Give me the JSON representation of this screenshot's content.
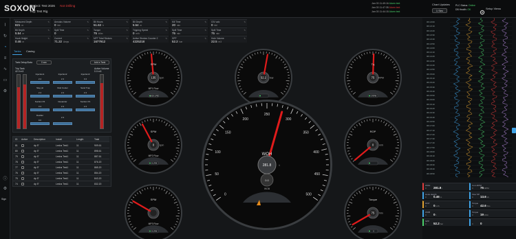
{
  "app": {
    "logo": "SOXON",
    "project": "Project:  Test 2026",
    "status": "Not Drilling",
    "rig": "Rig:  Test Rig"
  },
  "alarms": [
    {
      "time": "Jan 03 11:49:16",
      "text": "Alarm text"
    },
    {
      "time": "Jan 03 11:47:35",
      "text": "Alarm text"
    },
    {
      "time": "Jan 03 11:44:15",
      "text": "Alarm text"
    }
  ],
  "chart_updates": {
    "label": "Chart Updates",
    "value": "1 Sec"
  },
  "status_info": {
    "plc": "PLC Status:",
    "plc_val": "Online",
    "db": "DB Health:",
    "db_val": "OK"
  },
  "setup_label": "Setup Views",
  "sidebar": {
    "icons": [
      "chart-icon",
      "history-icon",
      "gauge-icon",
      "layers-icon",
      "trend-icon",
      "folder-icon",
      "settings-icon",
      "gear-icon"
    ],
    "bottom_label": "Sign"
  },
  "metrics": [
    {
      "label": "Measured Depth",
      "value": "821",
      "unit": "m"
    },
    {
      "label": "Annulus Volume",
      "value": "0",
      "unit": "bbl"
    },
    {
      "label": "Bit Hours",
      "value": "51.63",
      "unit": "h"
    },
    {
      "label": "Bit Depth",
      "value": "5.54",
      "unit": "m"
    },
    {
      "label": "Kill Time",
      "value": "20",
      "unit": "min"
    },
    {
      "label": "GIV calc",
      "value": "0",
      "unit": "bbl"
    },
    {
      "label": "Bit Depth",
      "value": "5.54",
      "unit": "m"
    },
    {
      "label": "Spill Time",
      "value": "0",
      "unit": ""
    },
    {
      "label": "Torque",
      "value": "75",
      "unit": "kNm"
    },
    {
      "label": "Tripping Speed",
      "value": "0",
      "unit": "m/h"
    },
    {
      "label": "Spill Time",
      "value": "75",
      "unit": "min"
    },
    {
      "label": "Spill Time",
      "value": "75",
      "unit": "min"
    },
    {
      "label": "Hook Height",
      "value": "0.46",
      "unit": "m"
    },
    {
      "label": "Current",
      "value": "71.22",
      "unit": "Amps"
    },
    {
      "label": "MFT Total Strokes",
      "value": "1677912",
      "unit": ""
    },
    {
      "label": "Active Strokes Counter 2",
      "value": "4225218",
      "unit": ""
    },
    {
      "label": "SPP",
      "value": "52.2",
      "unit": "bar"
    },
    {
      "label": "Hole Volume",
      "value": "22.5",
      "unit": "m3"
    }
  ],
  "left_panel": {
    "tabs": [
      "Tanks",
      "Casing"
    ],
    "delay_label": "Tank Delay/Data",
    "delay_value": "0 sec",
    "add_label": "Add a Tank",
    "trip_tank": "Trip Tank",
    "trip_val": "42.0 m3",
    "active_vol": "Active Volume",
    "active_val": "0.0 m3",
    "tanks": [
      {
        "name": "Injection1",
        "val": "2.4"
      },
      {
        "name": "Injection2",
        "val": "2.4"
      },
      {
        "name": "Injection3",
        "val": "3.4"
      },
      {
        "name": "Slug pit",
        "val": "2.4"
      },
      {
        "name": "Mud Cooler",
        "val": "2.4"
      },
      {
        "name": "Sand Trap",
        "val": "2.4"
      },
      {
        "name": "Suction P4",
        "val": "3.4"
      },
      {
        "name": "Desander",
        "val": "2.4"
      },
      {
        "name": "Suction P1",
        "val": "2.4"
      },
      {
        "name": "Desilter",
        "val": "0.0"
      },
      {
        "name": "",
        "val": "2.4"
      }
    ]
  },
  "table": {
    "headers": [
      "ID",
      "Active",
      "Description",
      "Install",
      "Length",
      "Total"
    ],
    "rows": [
      [
        "81",
        "",
        "dp 5\"",
        "Lesha Test1",
        "11",
        "909.61"
      ],
      [
        "80",
        "",
        "dp 5\"",
        "Lesha Test1",
        "11",
        "898.61"
      ],
      [
        "79",
        "",
        "dp 5\"",
        "Lesha Test1",
        "11",
        "887.61"
      ],
      [
        "78",
        "",
        "dp 5\"",
        "Lesha Test1",
        "11",
        "876.20"
      ],
      [
        "77",
        "",
        "dp 5\"",
        "Lesha Test1",
        "11",
        "865.20"
      ],
      [
        "76",
        "",
        "dp 5\"",
        "Lesha Test1",
        "11",
        "854.20"
      ],
      [
        "75",
        "",
        "dp 5\"",
        "Lesha Test1",
        "11",
        "843.20"
      ],
      [
        "74",
        "",
        "dp 5\"",
        "Lesha Test1",
        "11",
        "832.20"
      ]
    ]
  },
  "gauges": {
    "g1": {
      "title": "SPM",
      "value": "135",
      "unit": "spm",
      "sub": "MP1 Flow",
      "btn": "1000 LPM"
    },
    "g2": {
      "title": "",
      "value": "52.2",
      "unit": "Bar",
      "sub": "",
      "btn": ""
    },
    "g3": {
      "title": "Tq",
      "value": "75",
      "unit": "RPM",
      "sub": "",
      "btn": "0 RPM"
    },
    "g4": {
      "title": "SPM",
      "value": "0",
      "unit": "spm",
      "sub": "MP2 Flow",
      "btn": "0 LPM"
    },
    "g5": {
      "title": "ROP",
      "value": "0",
      "unit": "m/h",
      "sub": "",
      "btn": ""
    },
    "g6": {
      "title": "SPM",
      "value": "",
      "unit": "",
      "sub": "MP3 Flow",
      "btn": "0 LPM"
    },
    "g7": {
      "title": "Torque",
      "value": "75",
      "unit": "Nm",
      "sub": "",
      "btn": "0"
    },
    "big": {
      "title": "WOH",
      "value": "281.8",
      "unit": "t",
      "sub": "WOB",
      "sub_val": "0.0",
      "ticks": [
        "0",
        "50",
        "100",
        "150",
        "200",
        "250",
        "300",
        "350",
        "400",
        "450",
        "500"
      ]
    }
  },
  "right_panel": {
    "track_labels": [
      "06:13:00",
      "06:13:10",
      "06:13:20",
      "06:13:30",
      "06:13:40",
      "06:13:50",
      "06:14:00",
      "06:14:10",
      "06:14:20",
      "06:14:30",
      "06:14:40",
      "06:14:50",
      "06:15:00",
      "06:15:10",
      "06:15:20",
      "06:15:30",
      "06:15:40",
      "06:15:50",
      "06:16:00",
      "06:16:10",
      "06:16:20",
      "06:16:30",
      "06:16:40",
      "06:16:50",
      "06:17:00",
      "06:17:10",
      "06:17:20",
      "06:17:30",
      "06:17:40",
      "06:17:50",
      "06:18:00",
      "06:18:10",
      "06:18:20",
      "06:18:30",
      "06:18:40",
      "06:18:50"
    ],
    "cells": [
      {
        "label": "WOH",
        "value": "281.8",
        "unit": "t",
        "accent": "#e23c3c"
      },
      {
        "label": "Cum RPM",
        "value": "75",
        "unit": "RPM",
        "accent": "#3fa3e6"
      },
      {
        "label": "Hook Height",
        "value": "0.46",
        "unit": "m",
        "accent": "#3fa3e6"
      },
      {
        "label": "Flow SP",
        "value": "13.6",
        "unit": "t/s",
        "accent": "#3fa3e6"
      },
      {
        "label": "ROP",
        "value": "0",
        "unit": "m/h",
        "accent": "#e0a030"
      },
      {
        "label": "Torque",
        "value": "42.6",
        "unit": "Nm",
        "accent": "#3fa3e6"
      },
      {
        "label": "WOB",
        "value": "0",
        "unit": "t",
        "accent": "#3fa3e6"
      },
      {
        "label": "Torque",
        "value": "19",
        "unit": "kNm",
        "accent": "#3fa3e6"
      },
      {
        "label": "SPP",
        "value": "52.2",
        "unit": "bar",
        "accent": "#4ad06a"
      },
      {
        "label": "",
        "value": "0",
        "unit": "",
        "accent": "#3fa3e6"
      }
    ]
  }
}
